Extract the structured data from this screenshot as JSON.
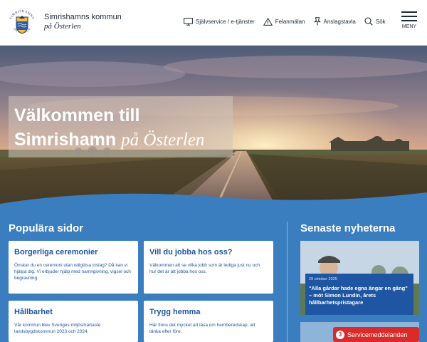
{
  "header": {
    "logo_text_top": "SIMRISHAMNS",
    "logo_text_bottom": "ÖSTERLEN",
    "brand_name": "Simrishamns kommun",
    "brand_sub": "på Österlen",
    "nav": [
      {
        "label": "Självservice / e-tjänster",
        "icon": "monitor-icon"
      },
      {
        "label": "Felanmälan",
        "icon": "warning-icon"
      },
      {
        "label": "Anslagstavla",
        "icon": "pushpin-icon"
      },
      {
        "label": "Sök",
        "icon": "search-icon"
      }
    ],
    "menu_label": "MENY"
  },
  "hero": {
    "line1": "Välkommen till",
    "line2_plain": "Simrishamn",
    "line2_italic": "på Österlen"
  },
  "popular": {
    "title": "Populära sidor",
    "cards": [
      {
        "title": "Borgerliga ceremonier",
        "text": "Önskar du en ceremoni utan religiösa inslag? Då kan vi hjälpa dig. Vi erbjuder hjälp med namngivning, vigsel och begravning."
      },
      {
        "title": "Vill du jobba hos oss?",
        "text": "Välkommen att se vilka jobb som är lediga just nu och hur det är att jobba hos oss."
      },
      {
        "title": "Hållbarhet",
        "text": "Vår kommun blev Sveriges miljösmartaste landsbygdskommun 2023 och 2024."
      },
      {
        "title": "Trygg hemma",
        "text": "Här finns det mycket att läsa om hemberedskap, att tänka efter före."
      }
    ]
  },
  "news": {
    "title": "Senaste nyheterna",
    "items": [
      {
        "date": "29 oktober 2025",
        "headline": "\"Alla gårdar hade egna ängar en gång\" – möt Simon Lundin, årets hållbarhetspristagare"
      }
    ]
  },
  "service": {
    "count": "3",
    "label": "Servicemeddelanden"
  },
  "colors": {
    "brand_blue": "#1f56a3",
    "content_bg": "#3a7ec0",
    "alert_red": "#d92b2b"
  }
}
